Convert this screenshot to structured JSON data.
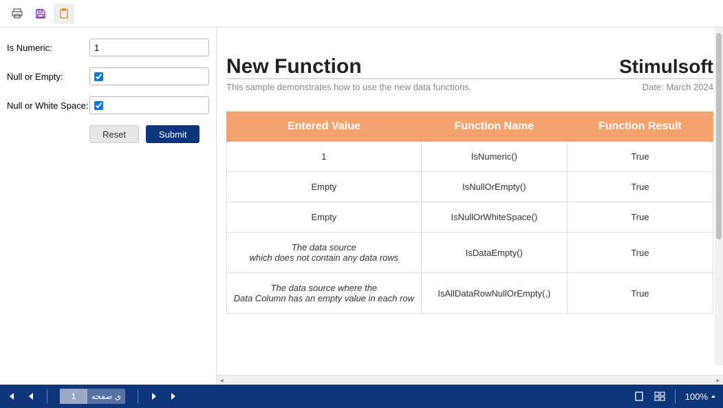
{
  "toolbar": {
    "print_icon": "print",
    "save_icon": "save",
    "clipboard_icon": "clipboard"
  },
  "form": {
    "isNumericLabel": "Is Numeric:",
    "isNumericValue": "1",
    "nullOrEmptyLabel": "Null or Empty:",
    "nullOrEmptyChecked": true,
    "nullOrWhiteSpaceLabel": "Null or White Space:",
    "nullOrWhiteSpaceChecked": true,
    "resetLabel": "Reset",
    "submitLabel": "Submit"
  },
  "report": {
    "title": "New Function",
    "brand": "Stimulsoft",
    "subtitle": "This sample demonstrates how to use the new data functions.",
    "dateText": "Date: March 2024",
    "columns": [
      "Entered Value",
      "Function Name",
      "Function Result"
    ],
    "rows": [
      {
        "entered": "1",
        "italic": false,
        "func": "IsNumeric()",
        "result": "True"
      },
      {
        "entered": "Empty",
        "italic": false,
        "func": "IsNullOrEmpty()",
        "result": "True"
      },
      {
        "entered": "Empty",
        "italic": false,
        "func": "IsNullOrWhiteSpace()",
        "result": "True"
      },
      {
        "entered": "The data source\nwhich does not contain any data rows",
        "italic": true,
        "func": "IsDataEmpty()",
        "result": "True"
      },
      {
        "entered": "The data source where the\nData Column has an empty value in each row",
        "italic": true,
        "func": "IsAllDataRowNullOrEmpty(,)",
        "result": "True"
      }
    ]
  },
  "statusbar": {
    "pageTextSuffix": "ی صفحه",
    "pageNumber": "1",
    "zoom": "100%"
  }
}
